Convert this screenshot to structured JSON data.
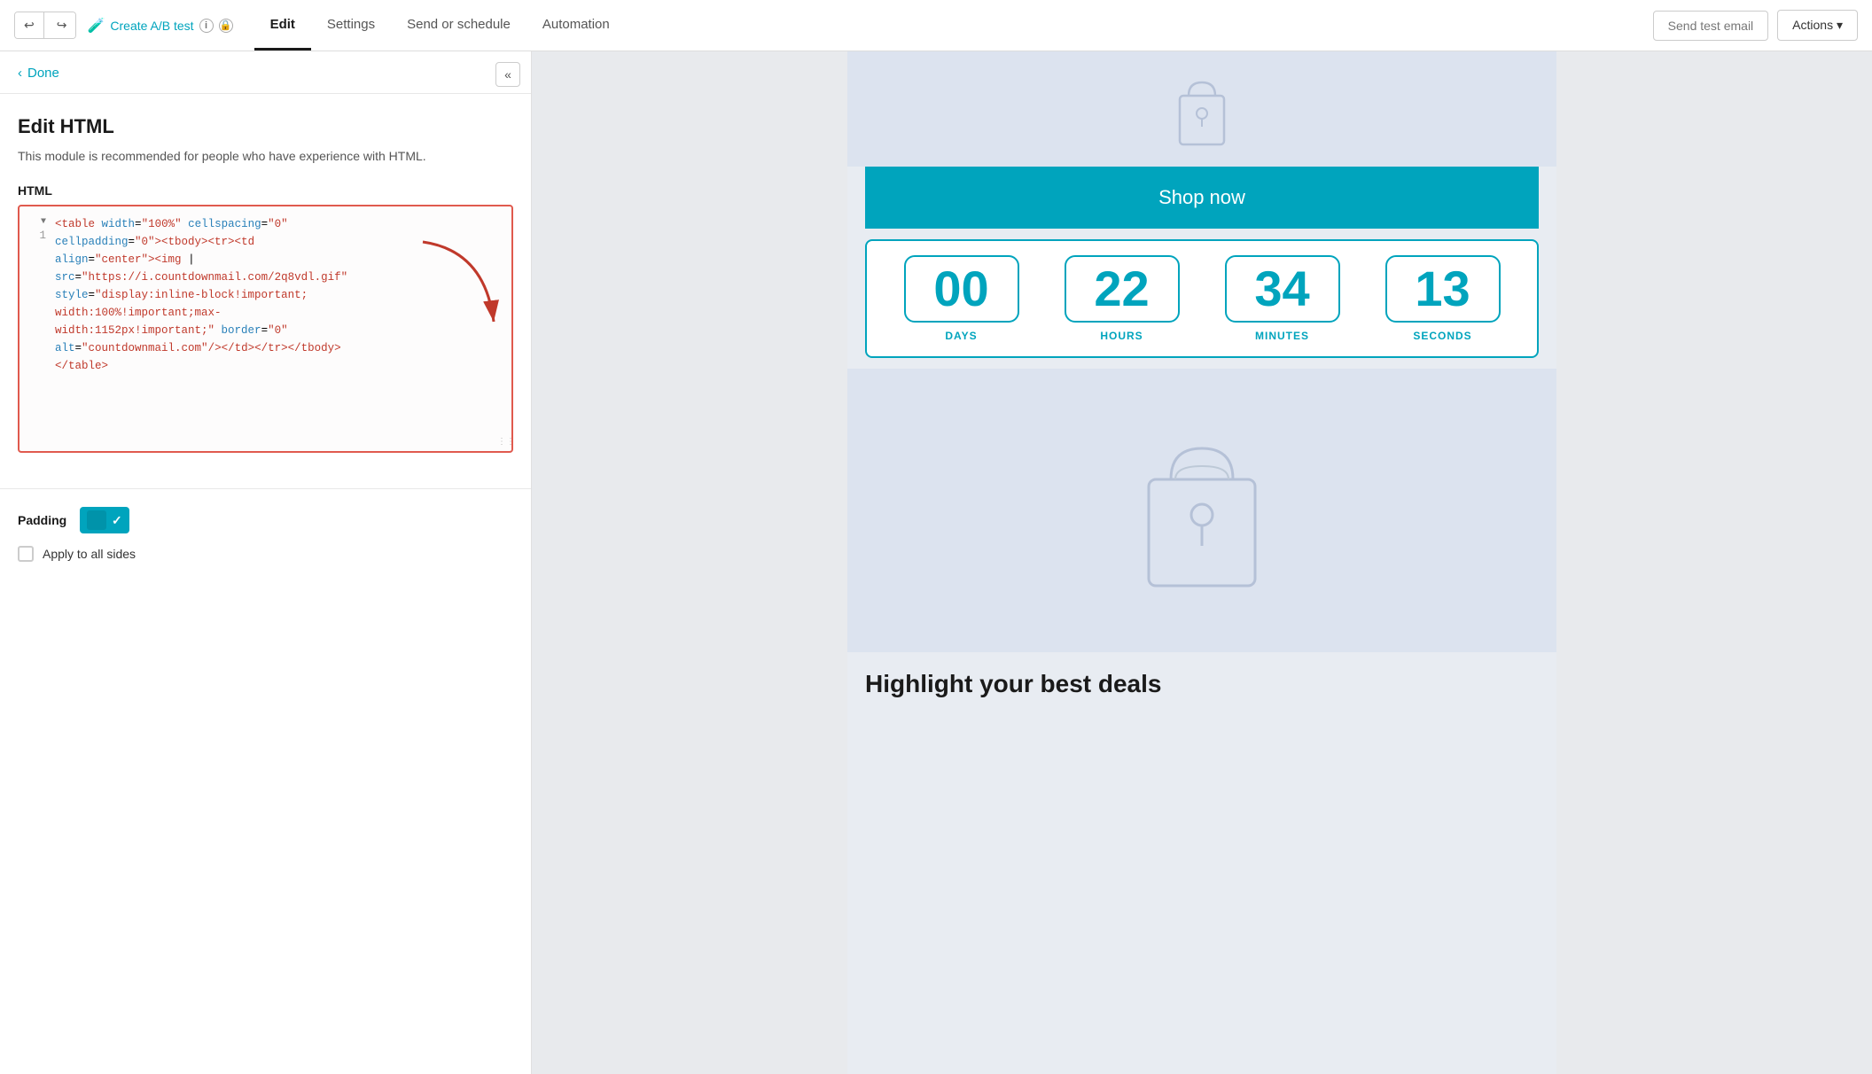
{
  "nav": {
    "undo_label": "↩",
    "redo_label": "↪",
    "ab_test_label": "Create A/B test",
    "tabs": [
      {
        "label": "Edit",
        "active": true
      },
      {
        "label": "Settings",
        "active": false
      },
      {
        "label": "Send or schedule",
        "active": false
      },
      {
        "label": "Automation",
        "active": false
      }
    ],
    "send_test_label": "Send test email",
    "actions_label": "Actions ▾"
  },
  "panel": {
    "collapse_icon": "«",
    "done_label": "Done",
    "edit_html_title": "Edit HTML",
    "edit_html_desc": "This module is recommended for people who have experience with HTML.",
    "html_label": "HTML",
    "code_line1": "<table width=\"100%\" cellspacing=\"0\"",
    "code_line2": "cellpadding=\"0\"><tbody><tr><td",
    "code_line3": "align=\"center\"><img |",
    "code_line4": "src=\"https://i.countdownmail.com/2q8vdl.gif\"",
    "code_line5": "style=\"display:inline-block!important;",
    "code_line6": "width:100%!important;max-",
    "code_line7": "width:1152px!important;\" border=\"0\"",
    "code_line8": "alt=\"countdownmail.com\"/></td></tr></tbody>",
    "code_line9": "</table>",
    "padding_label": "Padding",
    "apply_all_label": "Apply to all sides"
  },
  "preview": {
    "shop_now_label": "Shop now",
    "countdown": {
      "days": "00",
      "hours": "22",
      "minutes": "34",
      "seconds": "13",
      "days_label": "DAYS",
      "hours_label": "HOURS",
      "minutes_label": "MINUTES",
      "seconds_label": "SECONDS"
    },
    "highlight_title": "Highlight your best deals"
  }
}
